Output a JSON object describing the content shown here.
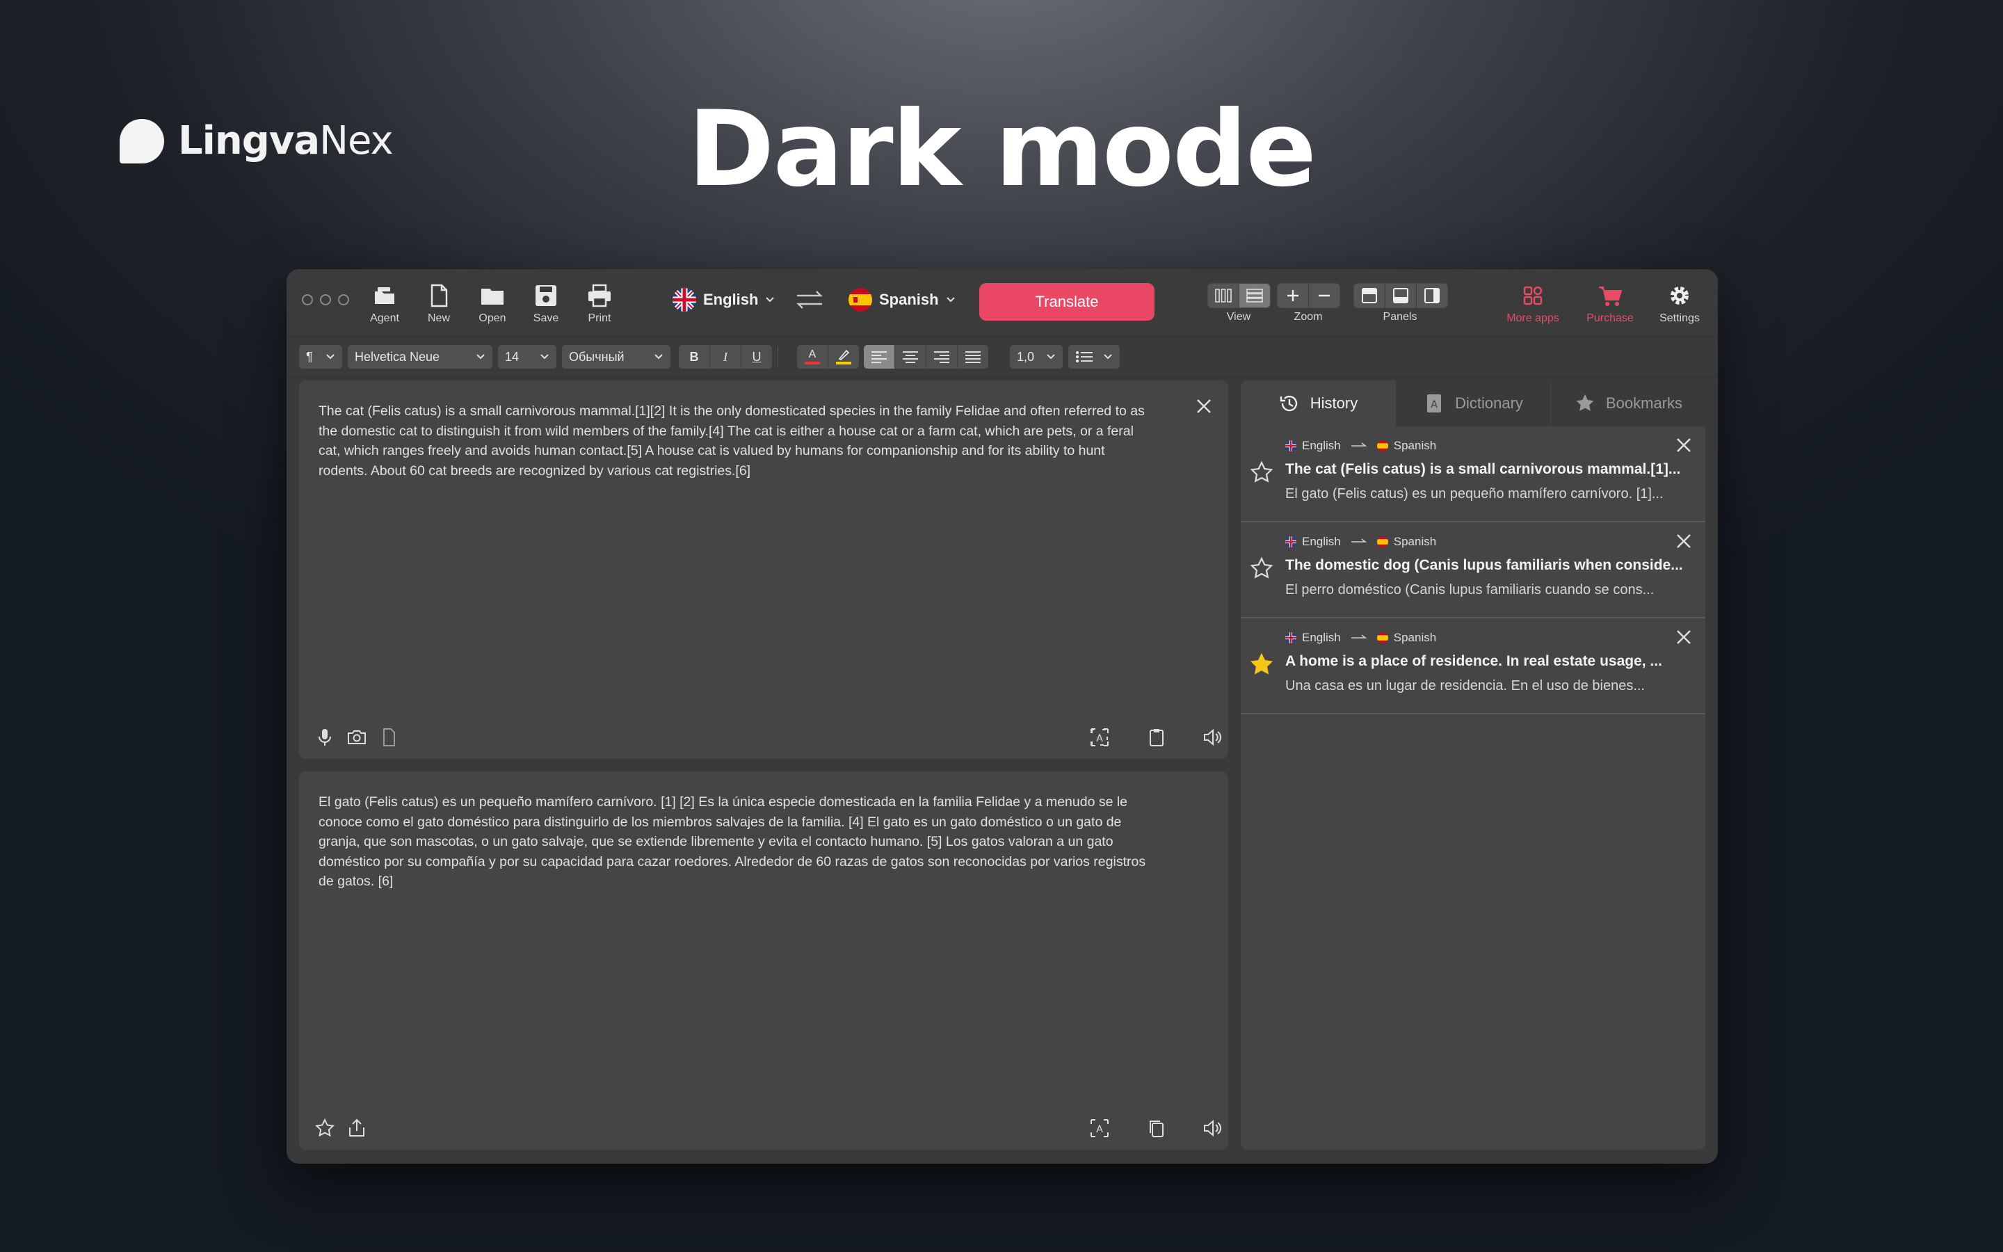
{
  "brand": {
    "name_bold": "Lingva",
    "name_light": "Nex"
  },
  "hero": {
    "title": "Dark mode"
  },
  "toolbar": {
    "agent": "Agent",
    "new": "New",
    "open": "Open",
    "save": "Save",
    "print": "Print",
    "source_lang": "English",
    "target_lang": "Spanish",
    "translate": "Translate",
    "view": "View",
    "zoom": "Zoom",
    "panels": "Panels",
    "more_apps": "More apps",
    "purchase": "Purchase",
    "settings": "Settings",
    "accent_color": "#ea4764"
  },
  "format": {
    "paragraph": "¶",
    "font": "Helvetica Neue",
    "size": "14",
    "style": "Обычный",
    "bold": "B",
    "italic": "I",
    "underline": "U",
    "text_color": "A",
    "line_spacing": "1,0"
  },
  "source": {
    "text": "The cat (Felis catus) is a small carnivorous mammal.[1][2] It is the only domesticated species in the family Felidae and often referred to as the domestic cat to distinguish it from wild members of the family.[4] The cat is either a house cat or a farm cat, which are pets, or a feral cat, which ranges freely and avoids human contact.[5] A house cat is valued by humans for companionship and for its ability to hunt rodents. About 60 cat breeds are recognized by various cat registries.[6]"
  },
  "target": {
    "text": "El gato (Felis catus) es un pequeño mamífero carnívoro. [1] [2] Es la única especie domesticada en la familia Felidae y a menudo se le conoce como el gato doméstico para distinguirlo de los miembros salvajes de la familia. [4] El gato es un gato doméstico o un gato de granja, que son mascotas, o un gato salvaje, que se extiende libremente y evita el contacto humano. [5] Los gatos valoran a un gato doméstico por su compañía y por su capacidad para cazar roedores. Alrededor de 60 razas de gatos son reconocidas por varios registros de gatos. [6]"
  },
  "sidebar": {
    "tabs": [
      "History",
      "Dictionary",
      "Bookmarks"
    ],
    "history": [
      {
        "from": "English",
        "to": "Spanish",
        "starred": false,
        "src": "The cat (Felis catus) is a small carnivorous mammal.[1]...",
        "dst": "El gato (Felis catus) es un pequeño mamífero carnívoro. [1]..."
      },
      {
        "from": "English",
        "to": "Spanish",
        "starred": false,
        "src": "The domestic dog (Canis lupus familiaris when conside...",
        "dst": "El perro doméstico (Canis lupus familiaris cuando se cons..."
      },
      {
        "from": "English",
        "to": "Spanish",
        "starred": true,
        "src": "A home is a place of residence. In real estate usage, ...",
        "dst": "Una casa es un lugar de residencia. En el uso de bienes..."
      }
    ],
    "star_color": "#f5c518"
  }
}
